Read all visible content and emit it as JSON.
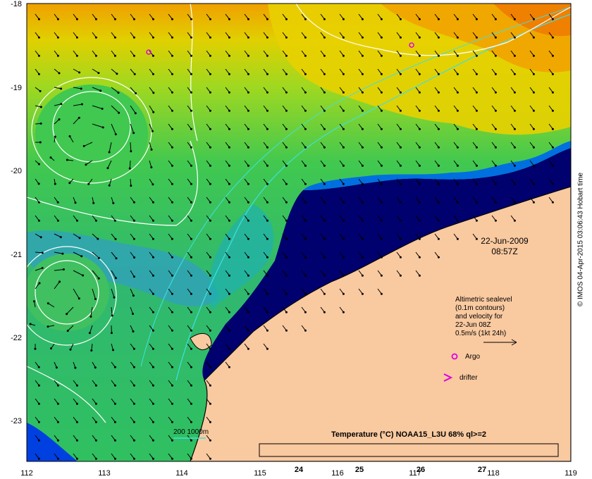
{
  "map": {
    "timestamp_date": "22-Jun-2009",
    "timestamp_time": "08:57Z",
    "lon_ticks": [
      "112",
      "113",
      "114",
      "115",
      "116",
      "117",
      "118",
      "119"
    ],
    "lat_ticks": [
      "-18",
      "-19",
      "-20",
      "-21",
      "-22",
      "-23"
    ],
    "depth_contour_label": "200 1000m",
    "credit": "© IMOS 04-Apr-2015 03:06:43 Hobart time"
  },
  "legend": {
    "lines": [
      "Altimetric sealevel",
      "(0.1m contours)",
      "and velocity for",
      "22-Jun 08Z",
      "0.5m/s (1kt 24h)"
    ],
    "argo_label": "Argo",
    "drifter_label": "drifter"
  },
  "colorbar": {
    "title": "Temperature (°C) NOAA15_L3U 68% ql>=2",
    "ticks": [
      "24",
      "25",
      "26",
      "27"
    ],
    "colors": [
      "#000060",
      "#00006e",
      "#00008a",
      "#0010b8",
      "#0040e0",
      "#0080ff",
      "#00b0ff",
      "#00d8e0",
      "#20e0b0",
      "#40d880",
      "#60d040",
      "#90d800",
      "#c0e000",
      "#e0e000",
      "#f0d000",
      "#f0b000",
      "#f09000",
      "#e06000",
      "#c03000",
      "#a01000",
      "#800000"
    ]
  },
  "colors": {
    "land": "#f9c9a0",
    "coast_deep": "#00006e",
    "ocean_green": "#30c060",
    "argo": "#e000e0",
    "sealevel_contour": "#ffffff",
    "bathymetry": "#40e0e0"
  }
}
